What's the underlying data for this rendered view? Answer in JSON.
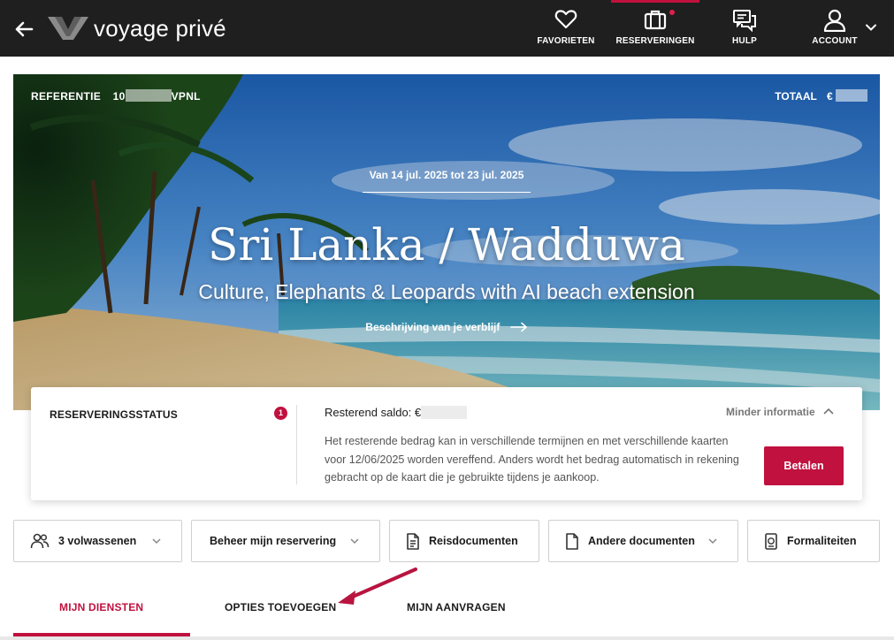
{
  "header": {
    "logo_text": "voyage privé",
    "nav": [
      {
        "label": "FAVORIETEN",
        "icon": "heart-icon"
      },
      {
        "label": "RESERVERINGEN",
        "icon": "suitcase-icon",
        "active": true,
        "notification": true
      },
      {
        "label": "HULP",
        "icon": "chat-icon"
      },
      {
        "label": "ACCOUNT",
        "icon": "user-icon"
      }
    ],
    "colors": {
      "background": "#1f1f1f",
      "accent": "#c0113f"
    }
  },
  "hero": {
    "reference_label": "REFERENTIE",
    "reference_value_start": "10",
    "reference_value_end": "VPNL",
    "total_label": "TOTAAL",
    "total_currency": "€",
    "dates": "Van 14 jul. 2025 tot 23 jul. 2025",
    "title": "Sri Lanka / Wadduwa",
    "subtitle": "Culture, Elephants & Leopards with AI beach extension",
    "description_link": "Beschrijving van je verblijf"
  },
  "status": {
    "title": "RESERVERINGSSTATUS",
    "badge_count": "1",
    "saldo_label": "Resterend saldo: €",
    "less_info": "Minder informatie",
    "body": "Het resterende bedrag kan in verschillende termijnen en met verschillende kaarten voor 12/06/2025 worden vereffend. Anders wordt het bedrag automatisch in rekening gebracht op de kaart die je gebruikte tijdens je aankoop.",
    "pay_button": "Betalen"
  },
  "actions": [
    {
      "label": "3 volwassenen",
      "icon": "people-icon",
      "dropdown": true
    },
    {
      "label": "Beheer mijn reservering",
      "dropdown": true
    },
    {
      "label": "Reisdocumenten",
      "icon": "document-icon",
      "dropdown": false
    },
    {
      "label": "Andere documenten",
      "icon": "file-icon",
      "dropdown": true
    },
    {
      "label": "Formaliteiten",
      "icon": "passport-icon",
      "dropdown": false
    }
  ],
  "tabs": [
    {
      "label": "MIJN DIENSTEN",
      "active": true
    },
    {
      "label": "OPTIES TOEVOEGEN",
      "active": false
    },
    {
      "label": "MIJN AANVRAGEN",
      "active": false
    }
  ]
}
